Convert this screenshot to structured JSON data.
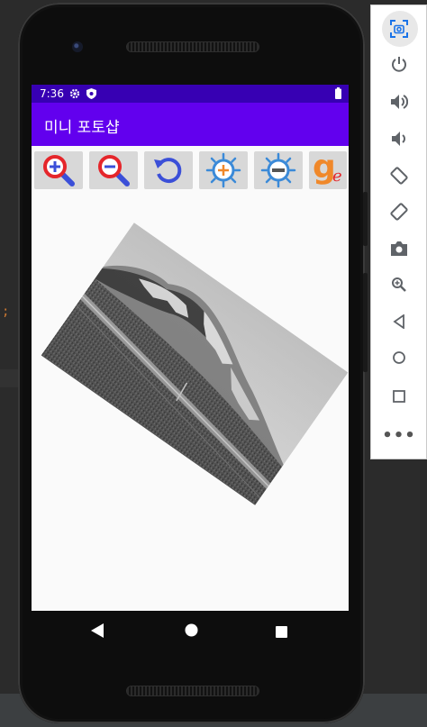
{
  "status_bar": {
    "time": "7:36",
    "icons": [
      "gear-icon",
      "shield-icon",
      "battery-icon"
    ]
  },
  "app_bar": {
    "title": "미니 포토샵"
  },
  "toolbar": {
    "buttons": [
      {
        "name": "zoom-in",
        "icon": "magnifier-plus-icon"
      },
      {
        "name": "zoom-out",
        "icon": "magnifier-minus-icon"
      },
      {
        "name": "rotate",
        "icon": "rotate-ccw-icon"
      },
      {
        "name": "brightness-up",
        "icon": "sun-plus-icon"
      },
      {
        "name": "brightness-down",
        "icon": "sun-minus-icon"
      },
      {
        "name": "grayscale",
        "icon": "g-logo-icon",
        "glyph": "g",
        "glyph_sub": "e"
      }
    ]
  },
  "image": {
    "rotation_deg": 35,
    "filter": "grayscale",
    "subject": "mountain-landscape"
  },
  "nav_bar": {
    "icons": [
      "back-triangle-icon",
      "home-circle-icon",
      "recents-square-icon"
    ]
  },
  "emulator_panel": {
    "icons": [
      "screenshot-camera-icon",
      "power-icon",
      "volume-up-icon",
      "volume-down-icon",
      "rotate-left-icon",
      "rotate-right-icon",
      "camera-icon",
      "zoom-icon",
      "back-icon",
      "home-icon",
      "overview-icon"
    ],
    "more_label": "•••"
  },
  "colors": {
    "status_bar": "#3700b3",
    "app_bar": "#6200ee",
    "icon_red": "#e5262b",
    "icon_blue": "#3b4fd8",
    "icon_orange": "#f0882a",
    "emu_icon": "#5f6368",
    "emu_accent": "#1a73e8"
  }
}
